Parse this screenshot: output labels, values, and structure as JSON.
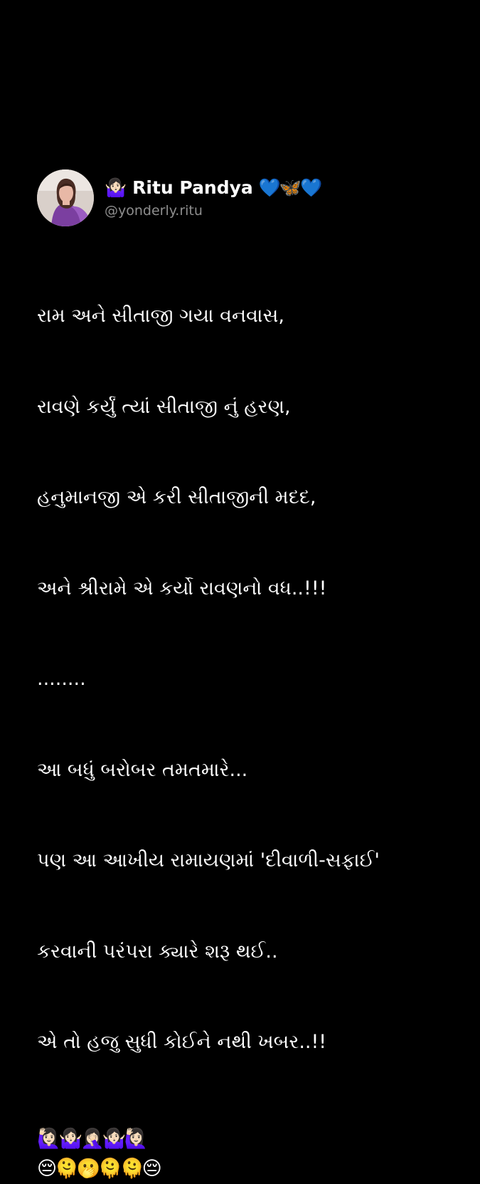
{
  "user": {
    "lead_emoji": "🤷🏻‍♀️",
    "name": "Ritu Pandya",
    "tail_emoji": "💙🦋💙",
    "handle": "@yonderly.ritu"
  },
  "post": {
    "lines": [
      "રામ અને સીતાજી ગયા વનવાસ,",
      "રાવણે કર્યું ત્યાં સીતાજી નું હરણ,",
      "હનુમાનજી એ કરી સીતાજીની મદદ,",
      "અને શ્રીરામે એ કર્યો રાવણનો વધ..!!!",
      "........",
      "આ બધું બરોબર તમતમારે...",
      "પણ આ આખીય રામાયણમાં 'દીવાળી-સફાઈ'",
      "કરવાની પરંપરા ક્યારે શરૂ થઈ..",
      "એ તો હજુ સુધી કોઈને નથી ખબર..!!"
    ],
    "emoji_line_1": "🙋🏻‍♀️🤷🏻‍♀️🤦🏻‍♀️🤷🏻‍♀️🙋🏻‍♀️",
    "emoji_line_2": "😔🫠🫢🫠🫠😔"
  },
  "colors": {
    "background": "#000000",
    "text": "#ffffff",
    "handle": "#8e8e8e",
    "avatar_bg": "#d8cfc8",
    "avatar_outfit": "#7b3fa0"
  }
}
